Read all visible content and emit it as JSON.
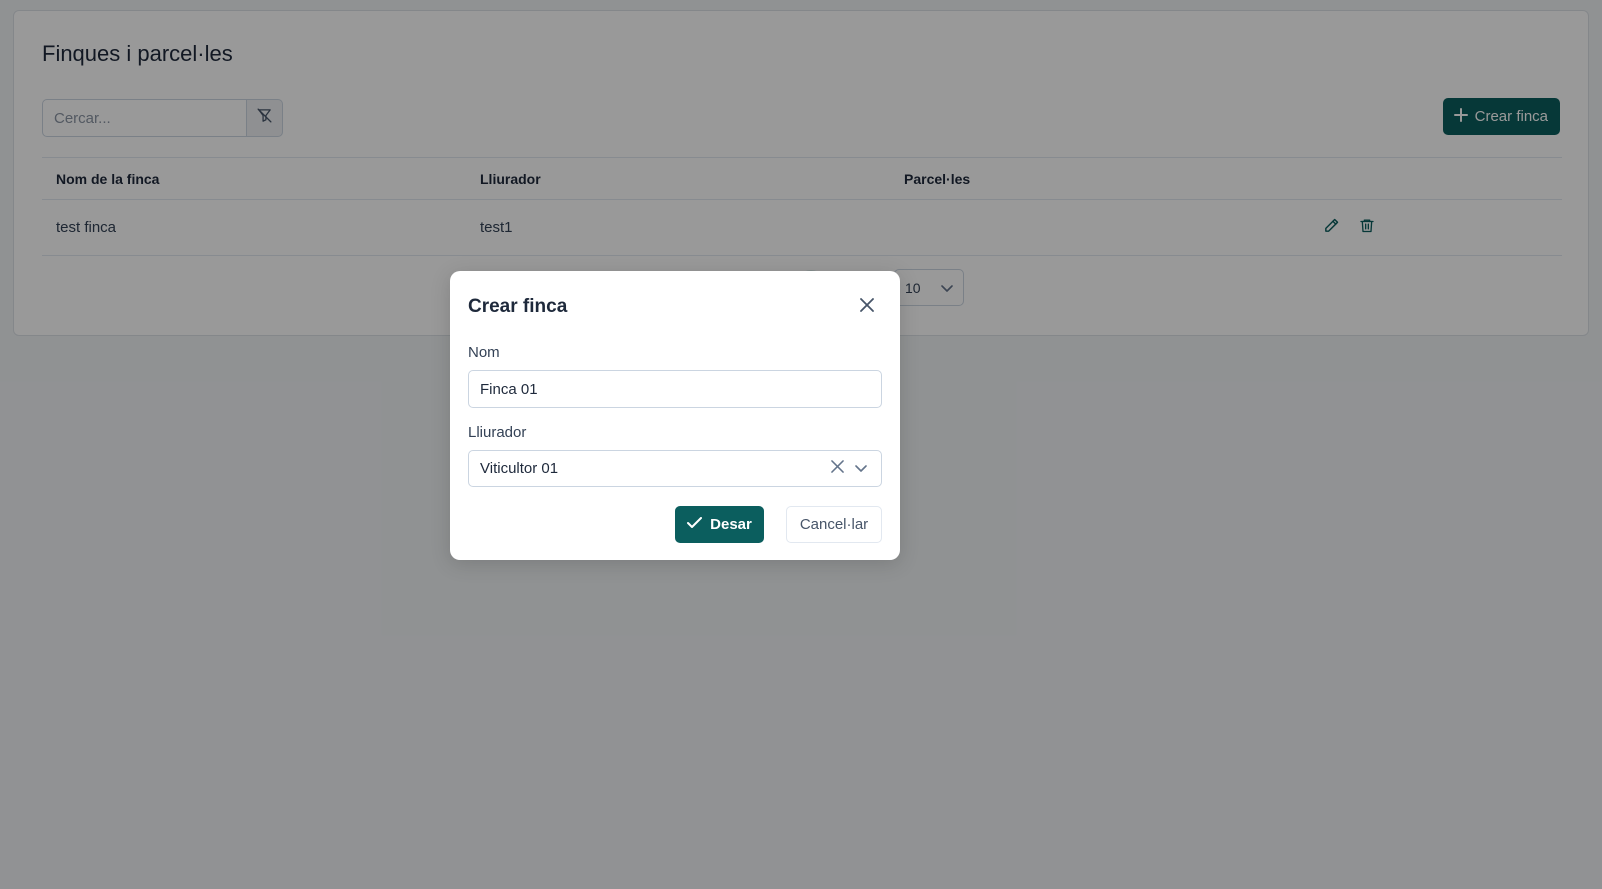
{
  "page": {
    "title": "Finques i parcel·les",
    "search_placeholder": "Cercar...",
    "create_button_label": "Crear finca"
  },
  "table": {
    "headers": [
      "Nom de la finca",
      "Lliurador",
      "Parcel·les"
    ],
    "rows": [
      {
        "name": "test finca",
        "supplier": "test1",
        "parcels": ""
      }
    ]
  },
  "pagination": {
    "rows_per_page": "10"
  },
  "modal": {
    "title": "Crear finca",
    "name_label": "Nom",
    "name_value": "Finca 01",
    "supplier_label": "Lliurador",
    "supplier_value": "Viticultor 01",
    "save_label": "Desar",
    "cancel_label": "Cancel·lar"
  },
  "colors": {
    "primary": "#0b5e5e",
    "overlay": "rgba(0,0,0,0.4)"
  },
  "icons": {
    "filter": "filter-clear-icon",
    "plus": "plus-icon",
    "edit": "pencil-icon",
    "delete": "trash-icon",
    "close": "close-icon",
    "chevron": "chevron-down-icon",
    "check": "check-icon"
  }
}
